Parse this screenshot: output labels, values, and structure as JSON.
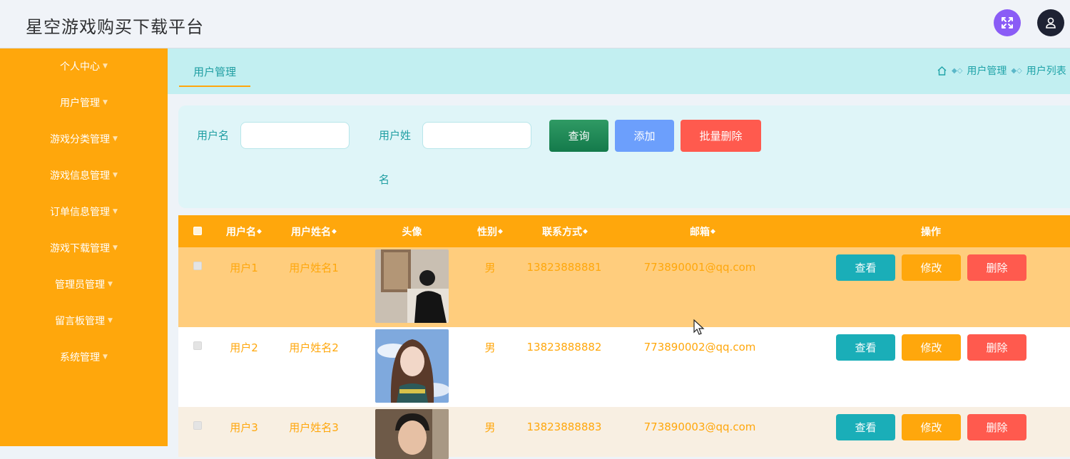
{
  "app": {
    "title": "星空游戏购买下载平台"
  },
  "header": {
    "fullscreen_icon": "expand-icon",
    "user_icon": "user-icon",
    "colors": {
      "fullscreen": "#8a5cf6",
      "user": "#1e2233"
    }
  },
  "sidebar": {
    "color": "#ffa70c",
    "items": [
      {
        "label": "个人中心"
      },
      {
        "label": "用户管理"
      },
      {
        "label": "游戏分类管理"
      },
      {
        "label": "游戏信息管理"
      },
      {
        "label": "订单信息管理"
      },
      {
        "label": "游戏下载管理"
      },
      {
        "label": "管理员管理"
      },
      {
        "label": "留言板管理"
      },
      {
        "label": "系统管理"
      }
    ]
  },
  "tabs": {
    "active": "用户管理"
  },
  "breadcrumb": {
    "home_icon": "home-icon",
    "items": [
      "用户管理",
      "用户列表"
    ]
  },
  "search": {
    "username_label": "用户名",
    "username_value": "",
    "realname_label_line1": "用户姓",
    "realname_label_line2": "名",
    "realname_value": "",
    "query_label": "查询",
    "add_label": "添加",
    "batch_delete_label": "批量删除"
  },
  "table": {
    "columns": {
      "username": "用户名",
      "realname": "用户姓名",
      "avatar": "头像",
      "gender": "性别",
      "phone": "联系方式",
      "email": "邮箱",
      "actions": "操作"
    },
    "sort_glyph": "◆",
    "rows": [
      {
        "username": "用户1",
        "realname": "用户姓名1",
        "gender": "男",
        "phone": "13823888881",
        "email": "773890001@qq.com",
        "view": "查看",
        "edit": "修改",
        "delete": "删除"
      },
      {
        "username": "用户2",
        "realname": "用户姓名2",
        "gender": "男",
        "phone": "13823888882",
        "email": "773890002@qq.com",
        "view": "查看",
        "edit": "修改",
        "delete": "删除"
      },
      {
        "username": "用户3",
        "realname": "用户姓名3",
        "gender": "男",
        "phone": "13823888883",
        "email": "773890003@qq.com",
        "view": "查看",
        "edit": "修改",
        "delete": "删除"
      }
    ],
    "row_colors": [
      "#ffcd7d",
      "#ffffff",
      "#f8efe2"
    ]
  }
}
